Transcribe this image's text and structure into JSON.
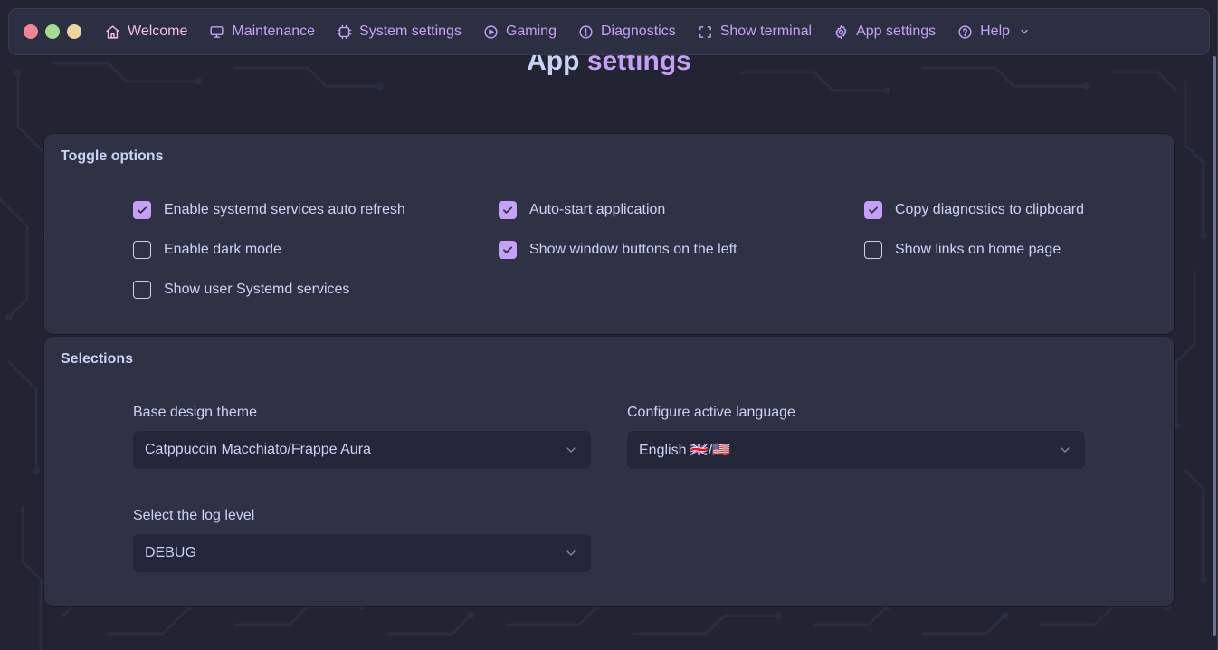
{
  "window": {
    "buttons": [
      "close",
      "maximize",
      "minimize"
    ]
  },
  "nav": {
    "items": [
      {
        "label": "Welcome",
        "icon": "home-icon"
      },
      {
        "label": "Maintenance",
        "icon": "monitor-icon"
      },
      {
        "label": "System settings",
        "icon": "cpu-icon"
      },
      {
        "label": "Gaming",
        "icon": "play-circle-icon"
      },
      {
        "label": "Diagnostics",
        "icon": "info-circle-icon"
      },
      {
        "label": "Show terminal",
        "icon": "scan-icon"
      },
      {
        "label": "App settings",
        "icon": "gear-icon"
      },
      {
        "label": "Help",
        "icon": "help-circle-icon",
        "has_dropdown": true
      }
    ]
  },
  "page": {
    "title_part1": "App",
    "title_part2": "settings"
  },
  "toggles": {
    "title": "Toggle options",
    "options": [
      {
        "label": "Enable systemd services auto refresh",
        "checked": true
      },
      {
        "label": "Auto-start application",
        "checked": true
      },
      {
        "label": "Copy diagnostics to clipboard",
        "checked": true
      },
      {
        "label": "Enable dark mode",
        "checked": false
      },
      {
        "label": "Show window buttons on the left",
        "checked": true
      },
      {
        "label": "Show links on home page",
        "checked": false
      },
      {
        "label": "Show user Systemd services",
        "checked": false
      }
    ]
  },
  "selections": {
    "title": "Selections",
    "theme": {
      "label": "Base design theme",
      "value": "Catppuccin Macchiato/Frappe Aura"
    },
    "language": {
      "label": "Configure active language",
      "value": "English 🇬🇧/🇺🇸"
    },
    "log_level": {
      "label": "Select the log level",
      "value": "DEBUG"
    }
  },
  "colors": {
    "accent": "#c6a0f6",
    "text": "#cad3f5",
    "background": "#222433",
    "card": "#2f3145",
    "close": "#ed8796",
    "maximize": "#a6da95",
    "minimize": "#eed49f"
  }
}
